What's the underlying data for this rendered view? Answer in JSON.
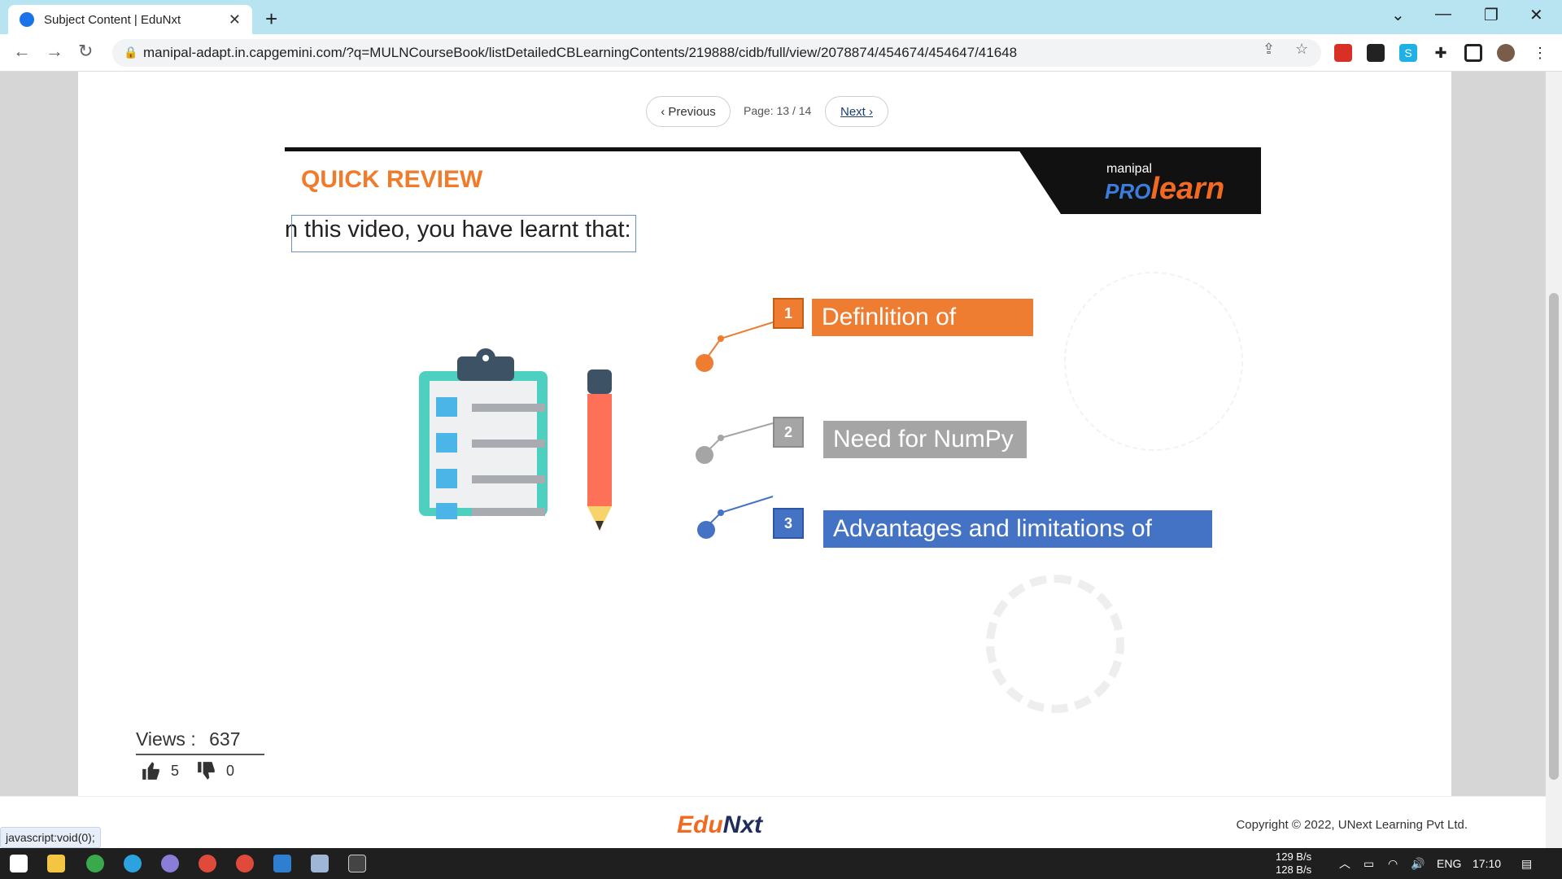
{
  "browser": {
    "tab_title": "Subject Content | EduNxt",
    "tab_close": "✕",
    "new_tab": "+",
    "url": "manipal-adapt.in.capgemini.com/?q=MULNCourseBook/listDetailedCBLearningContents/219888/cidb/full/view/2078874/454674/454647/41648"
  },
  "pager": {
    "previous": "‹ Previous",
    "page_label": "Page: 13 / 14",
    "next": "Next ›"
  },
  "slide": {
    "title": "QUICK REVIEW",
    "brand_small": "manipal",
    "brand_pro": "PRO",
    "brand_learn": "learn",
    "intro": "n this video, you have learnt that:",
    "items": [
      {
        "num": "1",
        "label": "Definlition of",
        "color": "#ee7d31"
      },
      {
        "num": "2",
        "label": "Need for NumPy",
        "color": "#a5a5a5"
      },
      {
        "num": "3",
        "label": "Advantages and limitations of",
        "color": "#4472c4"
      }
    ]
  },
  "stats": {
    "views_label": "Views :",
    "views_value": "637",
    "likes": "5",
    "dislikes": "0"
  },
  "footer": {
    "logo_edu": "Edu",
    "logo_nxt": "Nxt",
    "copyright": "Copyright © 2022, UNext Learning Pvt Ltd.",
    "status": "javascript:void(0);"
  },
  "taskbar": {
    "net_up": "129 B/s",
    "net_down": "128 B/s",
    "lang": "ENG",
    "time": "17:10"
  }
}
